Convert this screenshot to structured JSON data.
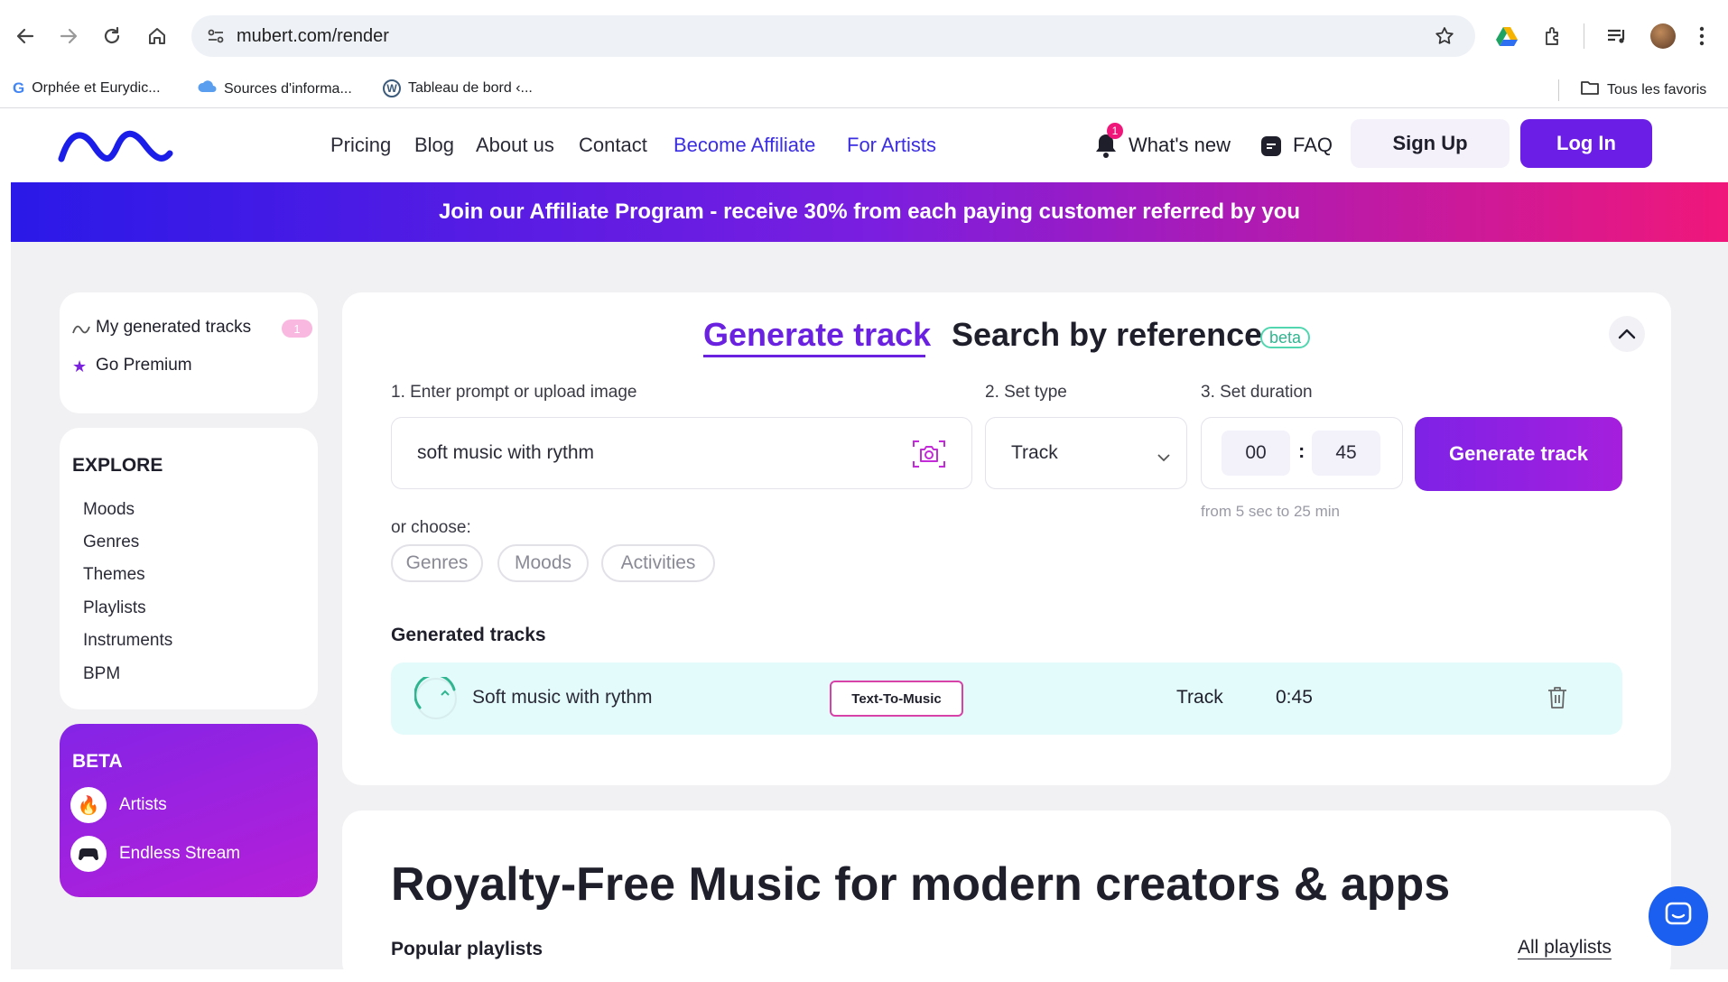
{
  "browser": {
    "url": "mubert.com/render",
    "bookmarks": [
      "Orphée et Eurydic...",
      "Sources d'informa...",
      "Tableau de bord ‹..."
    ],
    "all_bookmarks": "Tous les favoris"
  },
  "header": {
    "nav": [
      "Pricing",
      "Blog",
      "About us",
      "Contact",
      "Become Affiliate",
      "For Artists"
    ],
    "whats_new": "What's new",
    "notification_count": "1",
    "faq": "FAQ",
    "signup": "Sign Up",
    "login": "Log In"
  },
  "promo": "Join our Affiliate Program - receive 30% from each paying customer referred by you",
  "sidebar": {
    "my_tracks": "My generated tracks",
    "my_tracks_count": "1",
    "go_premium": "Go Premium",
    "explore_title": "EXPLORE",
    "explore_items": [
      "Moods",
      "Genres",
      "Themes",
      "Playlists",
      "Instruments",
      "BPM"
    ],
    "beta_title": "BETA",
    "beta_items": [
      "Artists",
      "Endless Stream"
    ]
  },
  "generator": {
    "tab_generate": "Generate track",
    "tab_search": "Search by reference",
    "beta_badge": "beta",
    "step1": "1. Enter prompt or upload image",
    "step2": "2. Set type",
    "step3": "3. Set duration",
    "prompt_value": "soft music with rythm",
    "type_value": "Track",
    "minutes": "00",
    "seconds": "45",
    "duration_hint": "from 5 sec to 25 min",
    "generate_label": "Generate track",
    "or_choose": "or choose:",
    "chips": [
      "Genres",
      "Moods",
      "Activities"
    ],
    "generated_title": "Generated tracks",
    "track": {
      "title": "Soft music with rythm",
      "tag": "Text-To-Music",
      "type": "Track",
      "duration": "0:45"
    }
  },
  "lower": {
    "headline": "Royalty-Free Music for modern creators & apps",
    "popular": "Popular playlists",
    "all_playlists": "All playlists"
  },
  "colors": {
    "accent": "#6b1ee5",
    "link_blue": "#3b2de0",
    "track_row_bg": "#e3fbfb"
  }
}
